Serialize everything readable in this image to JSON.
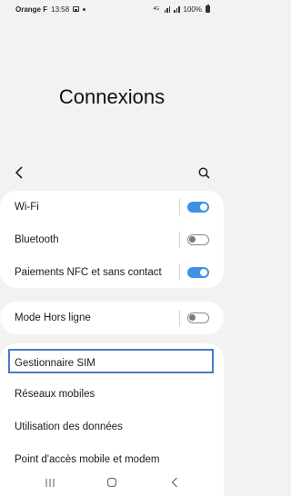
{
  "status_bar": {
    "carrier": "Orange F",
    "time": "13:58",
    "network": "4G",
    "battery": "100%"
  },
  "header": {
    "title": "Connexions"
  },
  "toolbar": {
    "back_icon": "chevron-left-icon",
    "search_icon": "search-icon"
  },
  "sections": {
    "wireless": [
      {
        "label": "Wi-Fi",
        "toggle": "on"
      },
      {
        "label": "Bluetooth",
        "toggle": "off"
      },
      {
        "label": "Paiements NFC et sans contact",
        "toggle": "on"
      }
    ],
    "airplane": [
      {
        "label": "Mode Hors ligne",
        "toggle": "off"
      }
    ],
    "more": [
      {
        "label": "Gestionnaire SIM",
        "highlighted": true
      },
      {
        "label": "Réseaux mobiles"
      },
      {
        "label": "Utilisation des données"
      },
      {
        "label": "Point d'accès mobile et modem"
      }
    ]
  },
  "colors": {
    "accent": "#3e91e6",
    "highlight_border": "#4a78c9",
    "background": "#f2f2f2"
  },
  "nav_bar": {
    "recents_icon": "recents-icon",
    "home_icon": "home-icon",
    "back_icon": "back-icon"
  }
}
